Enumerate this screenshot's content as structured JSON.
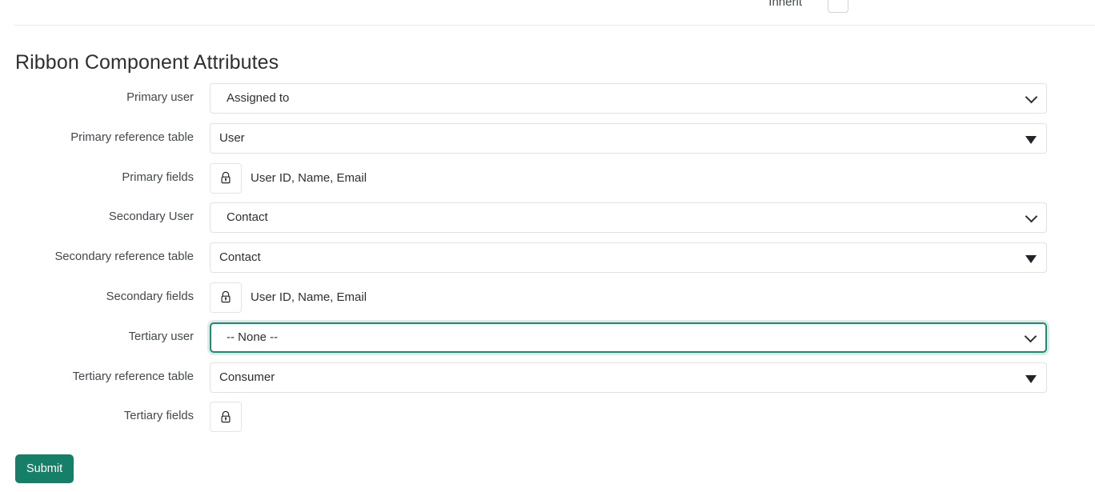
{
  "top_partial_row": {
    "label": "Inherit",
    "checkbox_checked": false,
    "checkbox_name": "inherit-checkbox"
  },
  "page_title": "Ribbon Component Attributes",
  "theme": {
    "accent": "#157f68",
    "focus_border": "#1f8a72",
    "border": "#dee2e6",
    "text": "#2c3034",
    "label_text": "#42484d",
    "divider": "#e7e9eb",
    "background": "#ffffff"
  },
  "rows": [
    {
      "label": "Primary user",
      "control": "select",
      "value": "Assigned to",
      "focused": false,
      "icon": "chevron-down-icon",
      "name": "primary-user"
    },
    {
      "label": "Primary reference table",
      "control": "dropdown",
      "value": "User",
      "focused": false,
      "icon": "caret-down-icon",
      "name": "primary-reference-table"
    },
    {
      "label": "Primary fields",
      "control": "lock",
      "value": "User ID, Name, Email",
      "icon": "lock-icon",
      "name": "primary-fields"
    },
    {
      "label": "Secondary User",
      "control": "select",
      "value": "Contact",
      "focused": false,
      "icon": "chevron-down-icon",
      "name": "secondary-user"
    },
    {
      "label": "Secondary reference table",
      "control": "dropdown",
      "value": "Contact",
      "focused": false,
      "icon": "caret-down-icon",
      "name": "secondary-reference-table"
    },
    {
      "label": "Secondary fields",
      "control": "lock",
      "value": "User ID, Name, Email",
      "icon": "lock-icon",
      "name": "secondary-fields"
    },
    {
      "label": "Tertiary user",
      "control": "select",
      "value": "-- None --",
      "focused": true,
      "icon": "chevron-down-icon",
      "name": "tertiary-user"
    },
    {
      "label": "Tertiary reference table",
      "control": "dropdown",
      "value": "Consumer",
      "focused": false,
      "icon": "caret-down-icon",
      "name": "tertiary-reference-table"
    },
    {
      "label": "Tertiary fields",
      "control": "lock",
      "value": "",
      "icon": "lock-icon",
      "name": "tertiary-fields"
    }
  ],
  "submit": {
    "label": "Submit"
  }
}
